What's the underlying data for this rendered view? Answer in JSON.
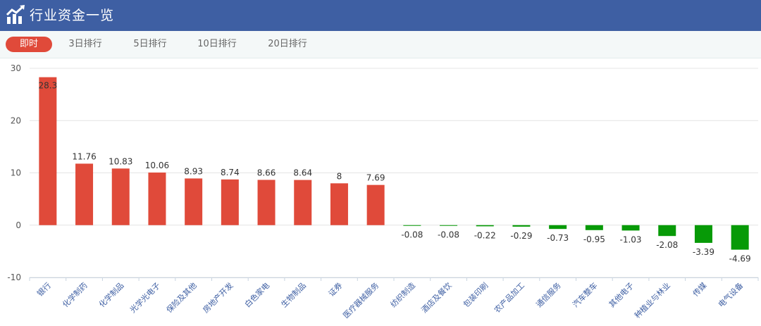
{
  "header": {
    "title": "行业资金一览",
    "icon": "trend-chart-icon"
  },
  "tabs": [
    {
      "label": "即时",
      "active": true
    },
    {
      "label": "3日排行",
      "active": false
    },
    {
      "label": "5日排行",
      "active": false
    },
    {
      "label": "10日排行",
      "active": false
    },
    {
      "label": "20日排行",
      "active": false
    }
  ],
  "colors": {
    "header_bg": "#3e5fa3",
    "positive": "#e04a3a",
    "negative": "#079a07",
    "active_tab": "#e04a3a"
  },
  "chart_data": {
    "type": "bar",
    "ylim": [
      -10,
      30
    ],
    "yticks": [
      -10,
      0,
      10,
      20,
      30
    ],
    "grid": true,
    "categories": [
      "银行",
      "化学制药",
      "化学制品",
      "光学光电子",
      "保险及其他",
      "房地产开发",
      "白色家电",
      "生物制品",
      "证券",
      "医疗器械服务",
      "纺织制造",
      "酒店及餐饮",
      "包装印刷",
      "农产品加工",
      "通信服务",
      "汽车整车",
      "其他电子",
      "种植业与林业",
      "传媒",
      "电气设备"
    ],
    "values": [
      28.3,
      11.76,
      10.83,
      10.06,
      8.93,
      8.74,
      8.66,
      8.64,
      8,
      7.69,
      -0.08,
      -0.08,
      -0.22,
      -0.29,
      -0.73,
      -0.95,
      -1.03,
      -2.08,
      -3.39,
      -4.69
    ],
    "value_labels": [
      "28.3",
      "11.76",
      "10.83",
      "10.06",
      "8.93",
      "8.74",
      "8.66",
      "8.64",
      "8",
      "7.69",
      "-0.08",
      "-0.08",
      "-0.22",
      "-0.29",
      "-0.73",
      "-0.95",
      "-1.03",
      "-2.08",
      "-3.39",
      "-4.69"
    ]
  }
}
